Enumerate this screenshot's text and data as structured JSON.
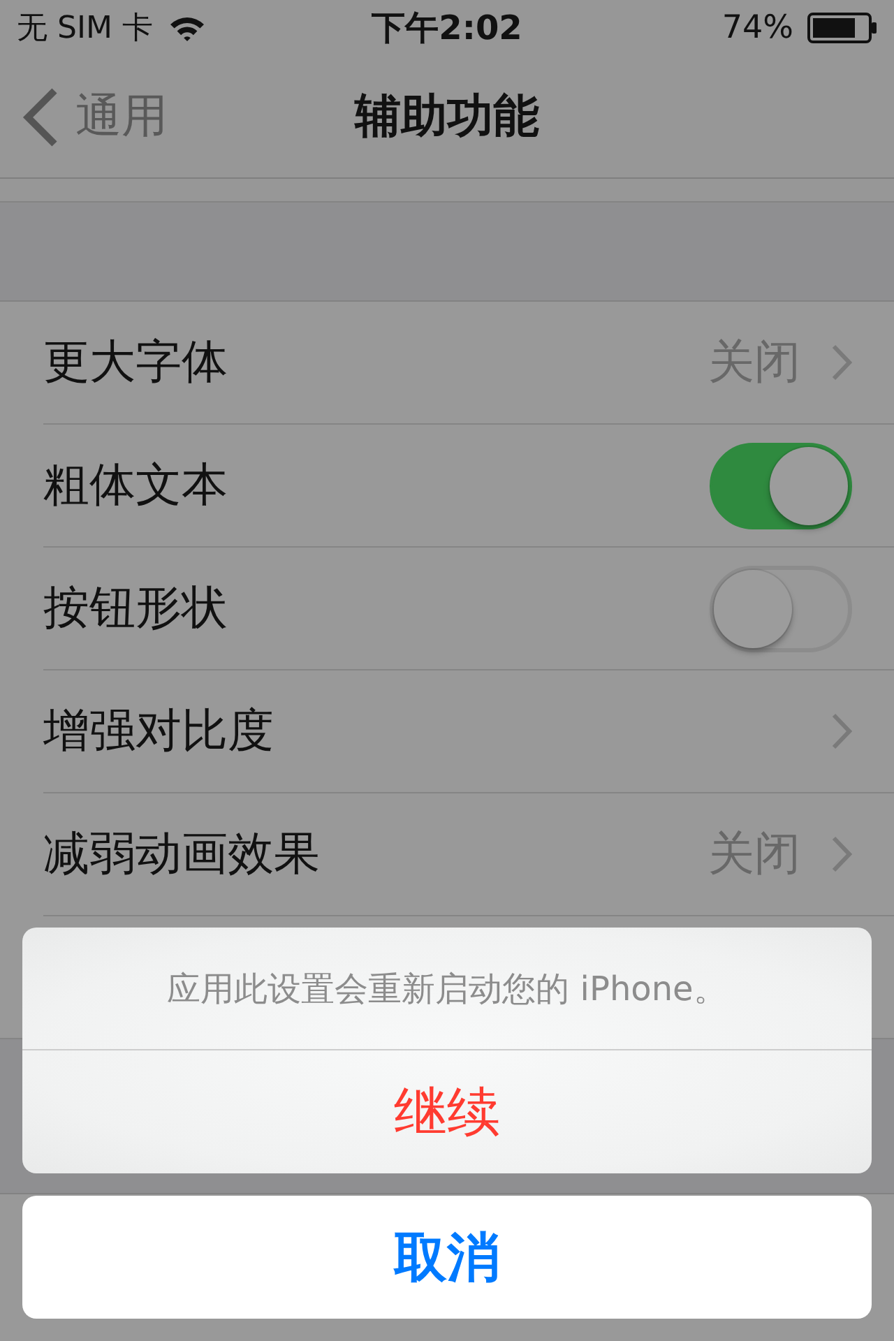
{
  "status_bar": {
    "carrier": "无 SIM 卡",
    "time": "下午2:02",
    "battery": "74%"
  },
  "nav_bar": {
    "back": "通用",
    "title": "辅助功能"
  },
  "settings": [
    {
      "kind": "disclosure",
      "label": "更大字体",
      "value": "关闭"
    },
    {
      "kind": "toggle",
      "label": "粗体文本",
      "on": true
    },
    {
      "kind": "toggle",
      "label": "按钮形状",
      "on": false
    },
    {
      "kind": "disclosure",
      "label": "增强对比度"
    },
    {
      "kind": "disclosure",
      "label": "减弱动画效果",
      "value": "关闭"
    }
  ],
  "action_sheet": {
    "message": "应用此设置会重新启动您的 iPhone。",
    "actions": [
      {
        "kind": "destructive",
        "label": "继续"
      }
    ],
    "cancel": "取消"
  }
}
